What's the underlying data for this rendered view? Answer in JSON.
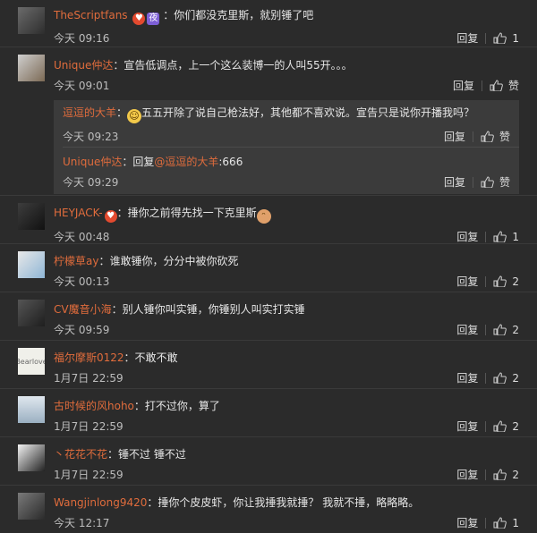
{
  "labels": {
    "reply": "回复",
    "like": "赞"
  },
  "comments": [
    {
      "user": "TheScriptfans",
      "badge1": "♥",
      "badge2": "夜",
      "text": "：你们都没克里斯，就别锤了吧",
      "time": "今天 09:16",
      "likes": "1"
    },
    {
      "user": "Unique仲达",
      "text": "：宣告低调点，上一个这么装博一的人叫55开。。。",
      "time": "今天 09:01",
      "likes": "赞",
      "replies": [
        {
          "user": "逗逗的大羊",
          "emoji": "😂",
          "text": "五五开除了说自己枪法好，其他都不喜欢说。宣告只是说你开播我吗？",
          "time": "今天 09:23",
          "likes": "赞"
        },
        {
          "user": "Unique仲达",
          "text_prefix": "：回复",
          "at": "@逗逗的大羊",
          "text": ":666",
          "time": "今天 09:29",
          "likes": "赞"
        }
      ]
    },
    {
      "user": "HEYJACK-",
      "badge1": "♥",
      "text": "：捶你之前得先找一下克里斯",
      "emoji": "🐱",
      "time": "今天 00:48",
      "likes": "1"
    },
    {
      "user": "柠檬草ay",
      "text": "：谁敢锤你，分分中被你砍死",
      "time": "今天 00:13",
      "likes": "2"
    },
    {
      "user": "CV魔音小海",
      "text": "：别人锤你叫实锤，你锤别人叫实打实锤",
      "time": "今天 09:59",
      "likes": "2"
    },
    {
      "user": "福尔摩斯0122",
      "avatar_text": "Bearlove",
      "text": "：不敢不敢",
      "time": "1月7日 22:59",
      "likes": "2"
    },
    {
      "user": "古时候的风hoho",
      "text": "：打不过你，算了",
      "time": "1月7日 22:59",
      "likes": "2"
    },
    {
      "user": "丶花花不花",
      "text": "：锤不过  锤不过",
      "time": "1月7日 22:59",
      "likes": "2"
    },
    {
      "user": "Wangjinlong9420",
      "text": "：捶你个皮皮虾，你让我捶我就捶？ 我就不捶，略略略。",
      "time": "今天 12:17",
      "likes": "1"
    }
  ]
}
